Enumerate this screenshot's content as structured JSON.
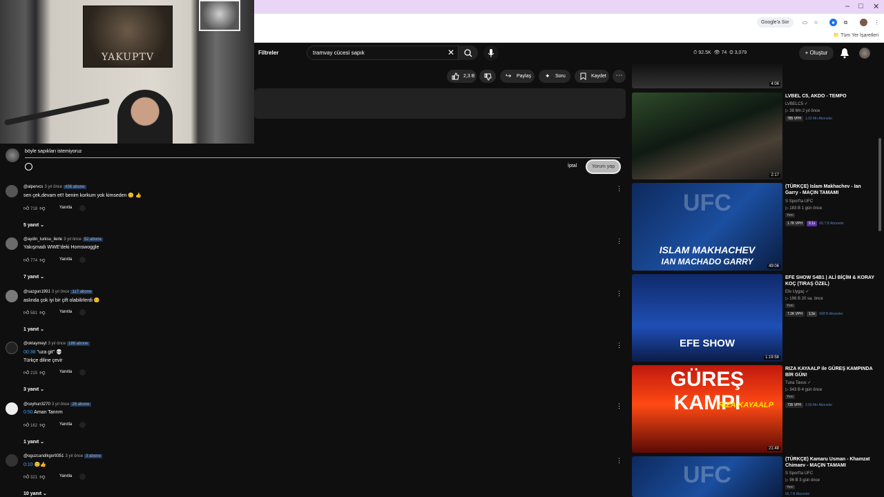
{
  "browser": {
    "window_controls": [
      "–",
      "□",
      "✕"
    ],
    "chip_label": "Google'a Sor",
    "bookmarks_label": "Tüm Yer İşaretleri"
  },
  "webcam": {
    "poster_text": "YAKUPTV"
  },
  "header": {
    "filters_label": "Filtreler",
    "search_value": "tramvay cücesi sapık",
    "stats": [
      "92.5K",
      "74",
      "3,079"
    ],
    "create_label": "Oluştur"
  },
  "actions": {
    "likes": "2,3 B",
    "share_label": "Paylaş",
    "ask_label": "Soru",
    "save_label": "Kaydet"
  },
  "comment_box": {
    "value": "böyle sapıkları istemiyoruz",
    "cancel_label": "İptal",
    "submit_label": "Yorum yap"
  },
  "comments": [
    {
      "author": "@alpervcs",
      "time": "3 yıl önce",
      "subs": "436 abone",
      "text": "sen çek,devam et!! benim korkum yok kimseden 😊 👍",
      "likes": "718",
      "reply": "Yanıtla",
      "replies": "5 yanıt"
    },
    {
      "author": "@aydin_turksu_ilerle",
      "time": "3 yıl önce",
      "subs": "52 abone",
      "text": "Yakışmadı WWE'deki Hornswoggle",
      "likes": "774",
      "reply": "Yanıtla",
      "replies": "7 yanıt"
    },
    {
      "author": "@sazgun1991",
      "time": "3 yıl önce",
      "subs": "117 abone",
      "text": "aslında çok iyi bir çift olabilirlerdi 😊",
      "likes": "581",
      "reply": "Yanıtla",
      "replies": "1 yanıt"
    },
    {
      "author": "@oktaymeyt",
      "time": "3 yıl önce",
      "subs": "186 abone",
      "ts": "00:38",
      "text": " \"uza git\" 💀",
      "text2": "Türkçe diline çevir",
      "likes": "215",
      "reply": "Yanıtla",
      "replies": "3 yanıt"
    },
    {
      "author": "@ceyhun3270",
      "time": "3 yıl önce",
      "subs": "26 abone",
      "ts": "0:50",
      "text": " Aman Tanrım",
      "likes": "162",
      "reply": "Yanıtla",
      "replies": "1 yanıt"
    },
    {
      "author": "@oguzcandikgor9351",
      "time": "3 yıl önce",
      "subs": "3 abone",
      "ts": "0:10",
      "text": " 😊👍",
      "likes": "321",
      "reply": "Yanıtla",
      "replies": "10 yanıt"
    }
  ],
  "sidebar": [
    {
      "duration": "4:06"
    },
    {
      "duration": "2:17",
      "title": "LVBEL C5, AKDO - TEMPO",
      "channel": "LVBELC5",
      "meta": "38 Mn  2 yıl önce",
      "vph": "785 VPH",
      "subs": "1,02 Mn Aboneler"
    },
    {
      "duration": "49:06",
      "thumb_line1": "ISLAM MAKHACHEV",
      "thumb_line2": "IAN MACHADO GARRY",
      "thumb_logo": "UFC",
      "title": "(TÜRKÇE) Islam Makhachev - Ian Garry - MAÇIN TAMAMI",
      "channel": "S Sport'ta UFC",
      "meta": "183 B  1 gün önce",
      "badge": "Yeni",
      "vph": "1.7K VPH",
      "mult": "9.1x",
      "subs": "66,7 B Aboneler"
    },
    {
      "duration": "1:19:58",
      "thumb_logo": "EFE SHOW",
      "title": "EFE SHOW S4B1 | ALİ BİÇİM & KORAY KOÇ (TIRAŞ ÖZEL)",
      "channel": "Efe Uygaç",
      "meta": "196 B  20 sa. önce",
      "badge": "Yeni",
      "vph": "7.2K VPH",
      "mult": "1.5x",
      "subs": "668 B Aboneler"
    },
    {
      "duration": "21:48",
      "thumb_line1": "GÜREŞ KAMPI",
      "thumb_line2": "RIZA KAYAALP",
      "title": "RIZA KAYAALP ile GÜREŞ KAMPINDA BİR GÜN!",
      "channel": "Tuna Tavus",
      "meta": "343 B  4 gün önce",
      "badge": "Yeni",
      "vph": "735 VPH",
      "subs": "2,66 Mn Aboneler"
    },
    {
      "thumb_logo": "UFC",
      "title": "(TÜRKÇE) Kamaru Usman - Khamzat Chimaev - MAÇIN TAMAMI",
      "channel": "S Sport'ta UFC",
      "meta": "96 B  3 gün önce",
      "badge": "Yeni",
      "subs": "66,7 B Aboneler"
    }
  ]
}
